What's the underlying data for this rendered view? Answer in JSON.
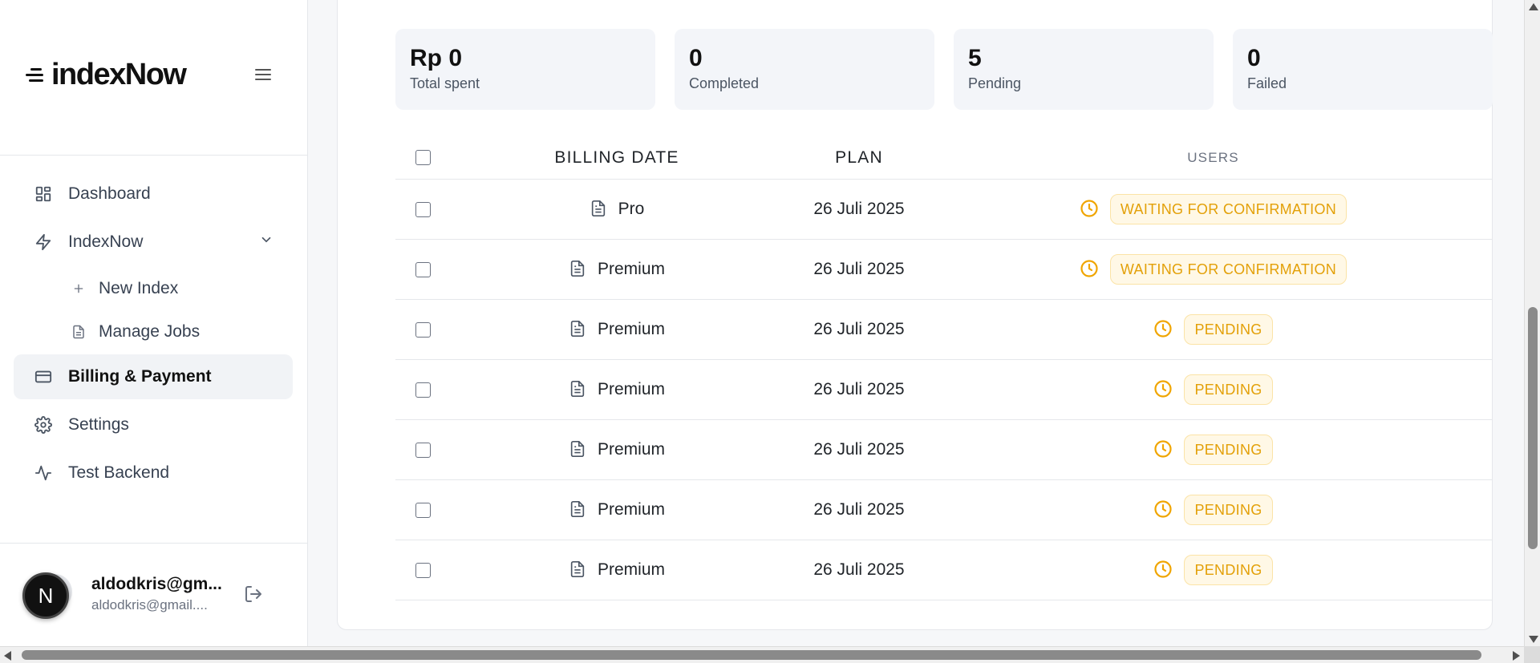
{
  "brand": {
    "logo_text": "indexNow"
  },
  "sidebar": {
    "items": [
      {
        "label": "Dashboard",
        "icon": "dashboard-grid-icon"
      },
      {
        "label": "IndexNow",
        "icon": "lightning-icon",
        "expanded": true,
        "children": [
          {
            "label": "New Index",
            "icon": "plus-icon"
          },
          {
            "label": "Manage Jobs",
            "icon": "document-icon"
          }
        ]
      },
      {
        "label": "Billing & Payment",
        "icon": "credit-card-icon",
        "active": true
      },
      {
        "label": "Settings",
        "icon": "gear-icon"
      },
      {
        "label": "Test Backend",
        "icon": "activity-icon"
      }
    ]
  },
  "user": {
    "avatar_letter": "N",
    "name": "aldodkris@gm...",
    "email": "aldodkris@gmail...."
  },
  "stats": [
    {
      "value": "Rp 0",
      "label": "Total spent"
    },
    {
      "value": "0",
      "label": "Completed"
    },
    {
      "value": "5",
      "label": "Pending"
    },
    {
      "value": "0",
      "label": "Failed"
    }
  ],
  "table": {
    "headers": {
      "billing_date": "BILLING DATE",
      "plan": "PLAN",
      "users": "USERS"
    },
    "rows": [
      {
        "plan": "Pro",
        "date": "26 Juli 2025",
        "status": "WAITING FOR CONFIRMATION"
      },
      {
        "plan": "Premium",
        "date": "26 Juli 2025",
        "status": "WAITING FOR CONFIRMATION"
      },
      {
        "plan": "Premium",
        "date": "26 Juli 2025",
        "status": "PENDING"
      },
      {
        "plan": "Premium",
        "date": "26 Juli 2025",
        "status": "PENDING"
      },
      {
        "plan": "Premium",
        "date": "26 Juli 2025",
        "status": "PENDING"
      },
      {
        "plan": "Premium",
        "date": "26 Juli 2025",
        "status": "PENDING"
      },
      {
        "plan": "Premium",
        "date": "26 Juli 2025",
        "status": "PENDING"
      }
    ]
  },
  "colors": {
    "status_text": "#e3a008",
    "status_bg": "#fff8e6",
    "active_nav_bg": "#f1f3f6"
  }
}
